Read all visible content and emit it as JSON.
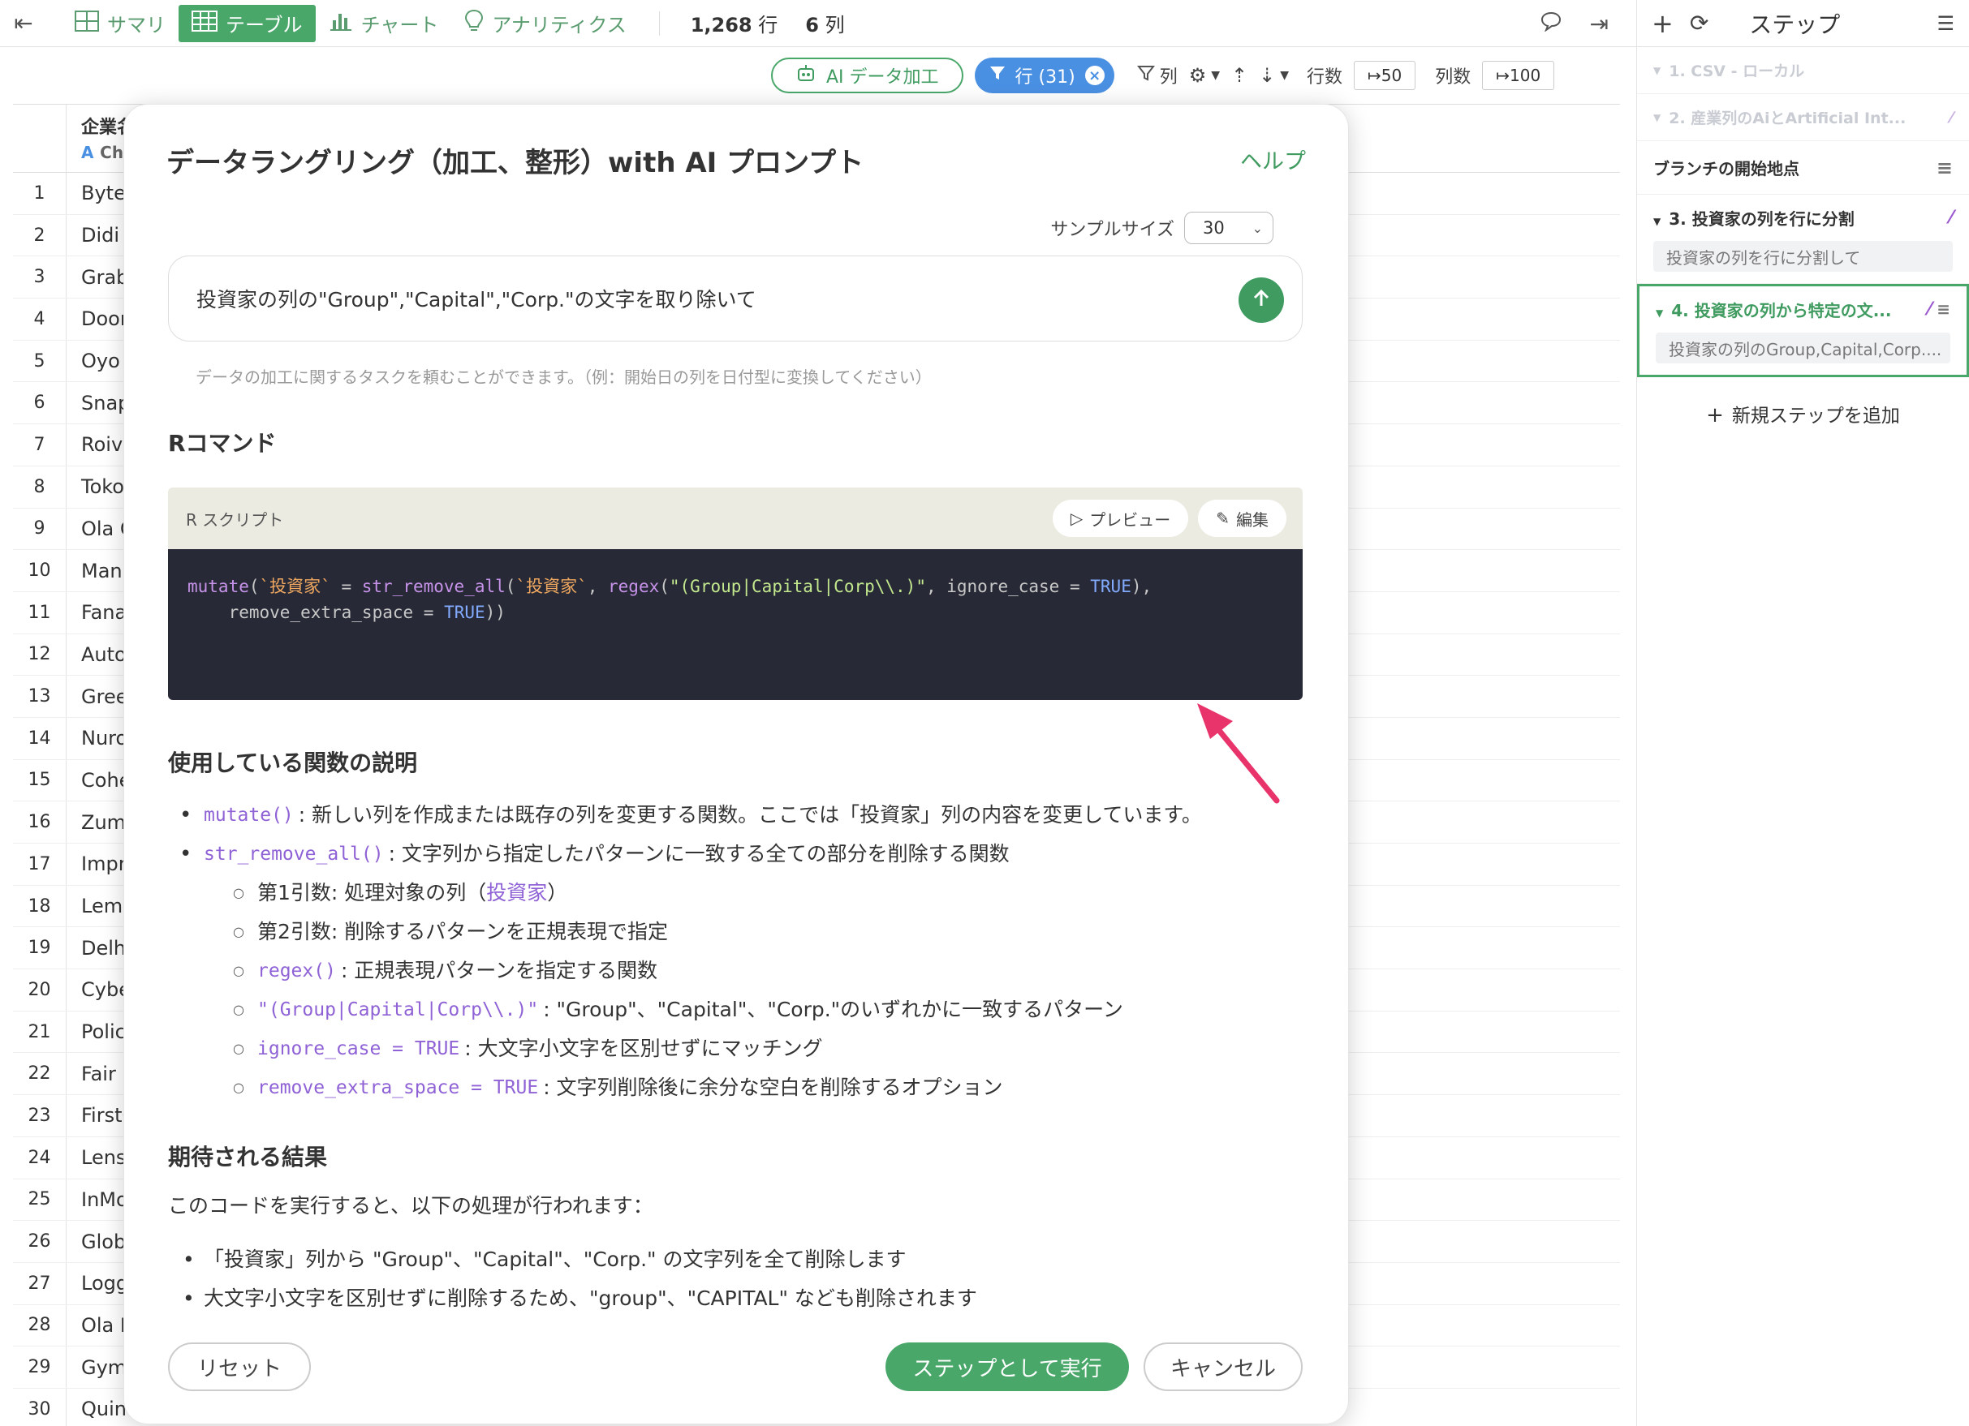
{
  "toolbar": {
    "tabs": [
      {
        "label": "サマリ",
        "icon": "grid-icon"
      },
      {
        "label": "テーブル",
        "icon": "table-icon"
      },
      {
        "label": "チャート",
        "icon": "bar-chart-icon"
      },
      {
        "label": "アナリティクス",
        "icon": "lightbulb-icon"
      }
    ],
    "row_count": "1,268",
    "row_unit": "行",
    "col_count": "6",
    "col_unit": "列"
  },
  "toolbar2": {
    "ai_label": "AI データ加工",
    "row_filter_label": "行 (31)",
    "col_label": "列",
    "rows_label": "行数",
    "rows_value": "50",
    "cols_label": "列数",
    "cols_value": "100"
  },
  "table": {
    "column_header": "企業名",
    "column_type_letter": "A",
    "column_type": "Character",
    "rows": [
      {
        "idx": "1",
        "value": "ByteDance"
      },
      {
        "idx": "2",
        "value": "Didi Chuxing"
      },
      {
        "idx": "3",
        "value": "Grab"
      },
      {
        "idx": "4",
        "value": "DoorDash"
      },
      {
        "idx": "5",
        "value": "Oyo Rooms"
      },
      {
        "idx": "6",
        "value": "Snapdeal"
      },
      {
        "idx": "7",
        "value": "Roivant"
      },
      {
        "idx": "8",
        "value": "Toko"
      },
      {
        "idx": "9",
        "value": "Ola Cabs"
      },
      {
        "idx": "10",
        "value": "Manbang"
      },
      {
        "idx": "11",
        "value": "Fanatics"
      },
      {
        "idx": "12",
        "value": "Automattic"
      },
      {
        "idx": "13",
        "value": "Greensill"
      },
      {
        "idx": "14",
        "value": "Nuro"
      },
      {
        "idx": "15",
        "value": "Cohesity"
      },
      {
        "idx": "16",
        "value": "Zume"
      },
      {
        "idx": "17",
        "value": "Improbable"
      },
      {
        "idx": "18",
        "value": "Lemonade"
      },
      {
        "idx": "19",
        "value": "Delhivery"
      },
      {
        "idx": "20",
        "value": "Cybereason"
      },
      {
        "idx": "21",
        "value": "Policybazaar"
      },
      {
        "idx": "22",
        "value": "Fair"
      },
      {
        "idx": "23",
        "value": "FirstCry"
      },
      {
        "idx": "24",
        "value": "Lenskart"
      },
      {
        "idx": "25",
        "value": "InMobi"
      },
      {
        "idx": "26",
        "value": "Global Switch"
      },
      {
        "idx": "27",
        "value": "Loggi"
      },
      {
        "idx": "28",
        "value": "Ola Electric"
      },
      {
        "idx": "29",
        "value": "Gympass"
      },
      {
        "idx": "30",
        "value": "Quintoandar"
      }
    ]
  },
  "right_panel": {
    "title": "ステップ",
    "steps_dim": [
      "1. CSV - ローカル",
      "2. 産業列のAiとArtificial Int..."
    ],
    "branch_label": "ブランチの開始地点",
    "step3": {
      "title": "3. 投資家の列を行に分割",
      "desc": "投資家の列を行に分割して"
    },
    "step4": {
      "title": "4. 投資家の列から特定の文...",
      "desc": "投資家の列のGroup,Capital,Corp...."
    },
    "add_step": "新規ステップを追加"
  },
  "modal": {
    "title": "データラングリング（加工、整形）with AI プロンプト",
    "help": "ヘルプ",
    "sample_label": "サンプルサイズ",
    "sample_value": "30",
    "prompt": "投資家の列の\"Group\",\"Capital\",\"Corp.\"の文字を取り除いて",
    "hint": "データの加工に関するタスクを頼むことができます。（例：開始日の列を日付型に変換してください）",
    "rcmd_title": "Rコマンド",
    "script_label": "R スクリプト",
    "preview_label": "プレビュー",
    "edit_label": "編集",
    "code": {
      "p1": "mutate",
      "p2": "(",
      "p3": "`投資家`",
      "p4": " = ",
      "p5": "str_remove_all",
      "p6": "(",
      "p7": "`投資家`",
      "p8": ", ",
      "p9": "regex",
      "p10": "(",
      "p11": "\"(Group|Capital|Corp\\\\.)\"",
      "p12": ", ignore_case = ",
      "p13": "TRUE",
      "p14": "),",
      "p15": "    remove_extra_space = ",
      "p16": "TRUE",
      "p17": "))"
    },
    "func_title": "使用している関数の説明",
    "funcs": {
      "mutate_code": "mutate()",
      "mutate_desc": ": 新しい列を作成または既存の列を変更する関数。ここでは「投資家」列の内容を変更しています。",
      "sra_code": "str_remove_all()",
      "sra_desc": ": 文字列から指定したパターンに一致する全ての部分を削除する関数",
      "arg1_a": "第1引数: 処理対象の列（",
      "arg1_b": "投資家",
      "arg1_c": "）",
      "arg2": "第2引数: 削除するパターンを正規表現で指定",
      "regex_code": "regex()",
      "regex_desc": ": 正規表現パターンを指定する関数",
      "pattern_code": "\"(Group|Capital|Corp\\\\.)\"",
      "pattern_desc": ": \"Group\"、\"Capital\"、\"Corp.\"のいずれかに一致するパターン",
      "ic_code": "ignore_case = TRUE",
      "ic_desc": ": 大文字小文字を区別せずにマッチング",
      "res_code": "remove_extra_space = TRUE",
      "res_desc": ": 文字列削除後に余分な空白を削除するオプション"
    },
    "result_title": "期待される結果",
    "result_intro": "このコードを実行すると、以下の処理が行われます：",
    "results": [
      "「投資家」列から \"Group\"、\"Capital\"、\"Corp.\" の文字列を全て削除します",
      "大文字小文字を区別せずに削除するため、\"group\"、\"CAPITAL\" なども削除されます"
    ],
    "reset": "リセット",
    "run": "ステップとして実行",
    "cancel": "キャンセル"
  },
  "colors": {
    "accent_green": "#4aa76a",
    "filter_blue": "#4a90e2",
    "code_bg": "#272a36",
    "annotation_pink": "#e8336b"
  }
}
